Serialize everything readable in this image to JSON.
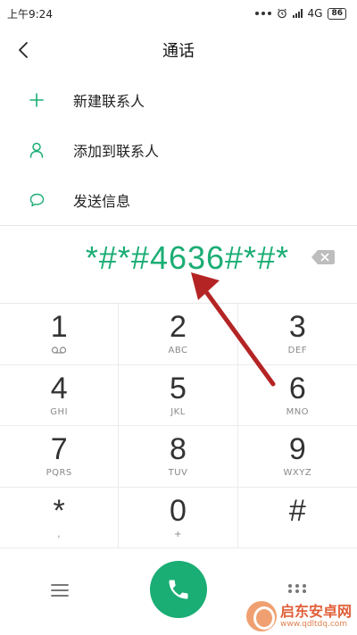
{
  "status_bar": {
    "time": "上午9:24",
    "network": "4G",
    "battery": "86"
  },
  "header": {
    "title": "通话"
  },
  "actions": [
    {
      "label": "新建联系人",
      "icon": "plus-icon"
    },
    {
      "label": "添加到联系人",
      "icon": "person-icon"
    },
    {
      "label": "发送信息",
      "icon": "message-bubble-icon"
    }
  ],
  "dialer": {
    "number": "*#*#4636#*#*"
  },
  "keypad": [
    {
      "digit": "1",
      "letters": ""
    },
    {
      "digit": "2",
      "letters": "ABC"
    },
    {
      "digit": "3",
      "letters": "DEF"
    },
    {
      "digit": "4",
      "letters": "GHI"
    },
    {
      "digit": "5",
      "letters": "JKL"
    },
    {
      "digit": "6",
      "letters": "MNO"
    },
    {
      "digit": "7",
      "letters": "PQRS"
    },
    {
      "digit": "8",
      "letters": "TUV"
    },
    {
      "digit": "9",
      "letters": "WXYZ"
    },
    {
      "digit": "*",
      "letters": ","
    },
    {
      "digit": "0",
      "letters": "+"
    },
    {
      "digit": "#",
      "letters": ""
    }
  ],
  "colors": {
    "accent": "#1aad74",
    "annotation_arrow": "#b52424"
  },
  "watermark": {
    "title": "启东安卓网",
    "url": "www.qdltdq.com"
  }
}
